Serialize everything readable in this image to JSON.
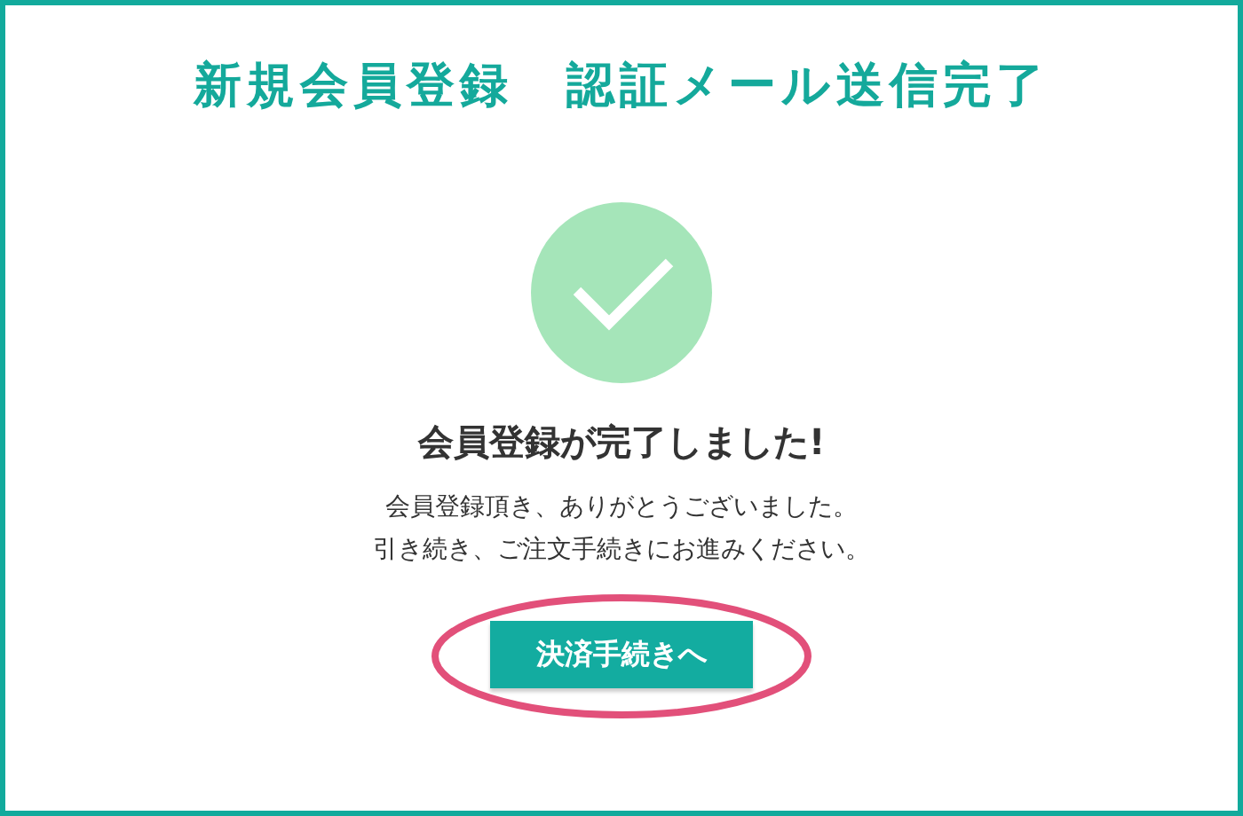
{
  "page_title": "新規会員登録　認証メール送信完了",
  "heading": "会員登録が完了しました!",
  "message": [
    "会員登録頂き、ありがとうございました。",
    "引き続き、ご注文手続きにお進みください。"
  ],
  "button": {
    "label": "決済手続きへ",
    "highlighted": true
  }
}
